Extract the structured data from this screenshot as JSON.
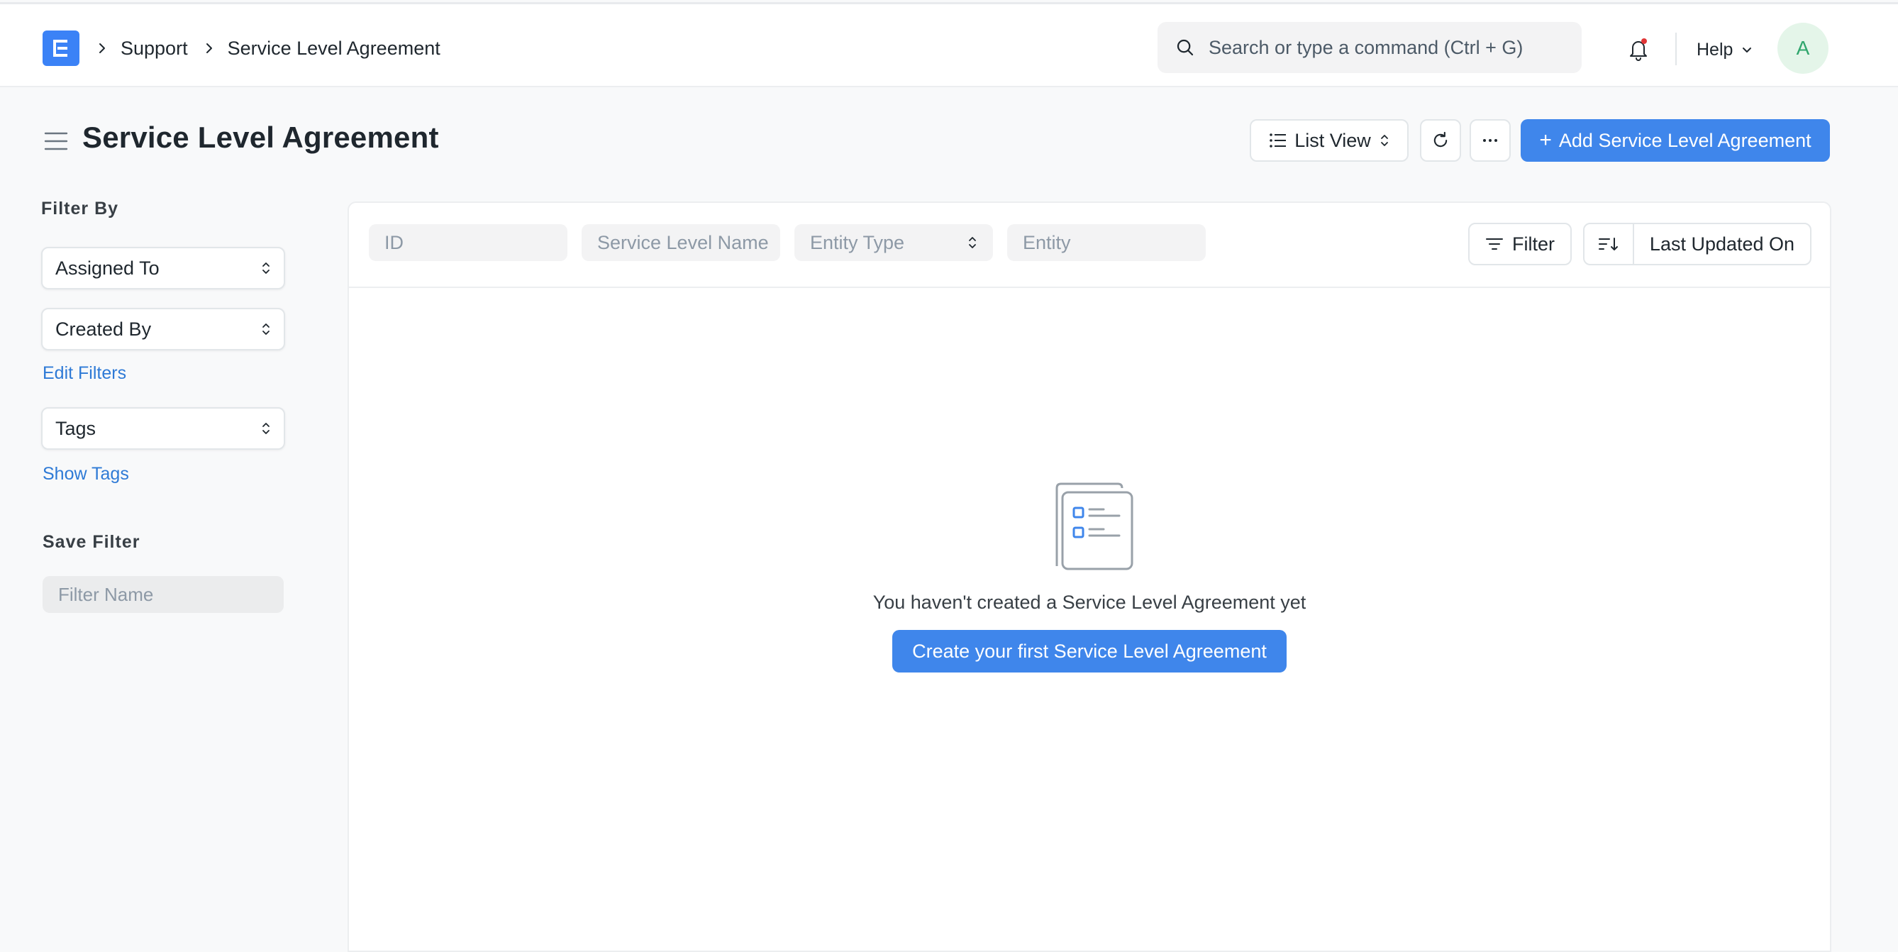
{
  "breadcrumbs": [
    {
      "label": "Support"
    },
    {
      "label": "Service Level Agreement"
    }
  ],
  "search": {
    "placeholder": "Search or type a command (Ctrl + G)"
  },
  "navbar": {
    "help_label": "Help",
    "avatar_initial": "A"
  },
  "page": {
    "title": "Service Level Agreement"
  },
  "toolbar": {
    "list_view_label": "List View",
    "add_label": "Add Service Level Agreement",
    "add_icon": "plus-icon"
  },
  "sidebar": {
    "filter_by_heading": "Filter By",
    "assigned_to_label": "Assigned To",
    "created_by_label": "Created By",
    "edit_filters_label": "Edit Filters",
    "tags_label": "Tags",
    "show_tags_label": "Show Tags",
    "save_filter_heading": "Save Filter",
    "filter_name_placeholder": "Filter Name"
  },
  "list_filters": {
    "id_placeholder": "ID",
    "service_level_name_placeholder": "Service Level Name",
    "entity_type_label": "Entity Type",
    "entity_placeholder": "Entity",
    "filter_label": "Filter",
    "sort_field_label": "Last Updated On"
  },
  "empty_state": {
    "message": "You haven't created a Service Level Agreement yet",
    "create_label": "Create your first Service Level Agreement"
  },
  "colors": {
    "primary": "#3f86eb",
    "logo": "#3b82f6",
    "link": "#2e7ad6",
    "notification_dot": "#e03636"
  }
}
